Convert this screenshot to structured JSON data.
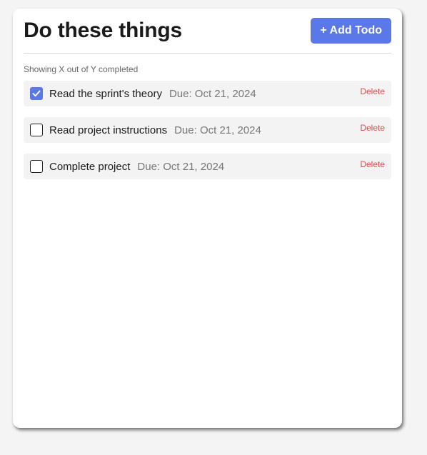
{
  "header": {
    "title": "Do these things",
    "add_label": "+ Add Todo"
  },
  "summary": "Showing X out of Y completed",
  "colors": {
    "accent": "#5a78e8",
    "delete": "#e14b4b"
  },
  "todos": [
    {
      "title": "Read the sprint's theory",
      "due": "Due: Oct 21, 2024",
      "completed": true,
      "delete_label": "Delete"
    },
    {
      "title": "Read project instructions",
      "due": "Due: Oct 21, 2024",
      "completed": false,
      "delete_label": "Delete"
    },
    {
      "title": "Complete project",
      "due": "Due: Oct 21, 2024",
      "completed": false,
      "delete_label": "Delete"
    }
  ]
}
